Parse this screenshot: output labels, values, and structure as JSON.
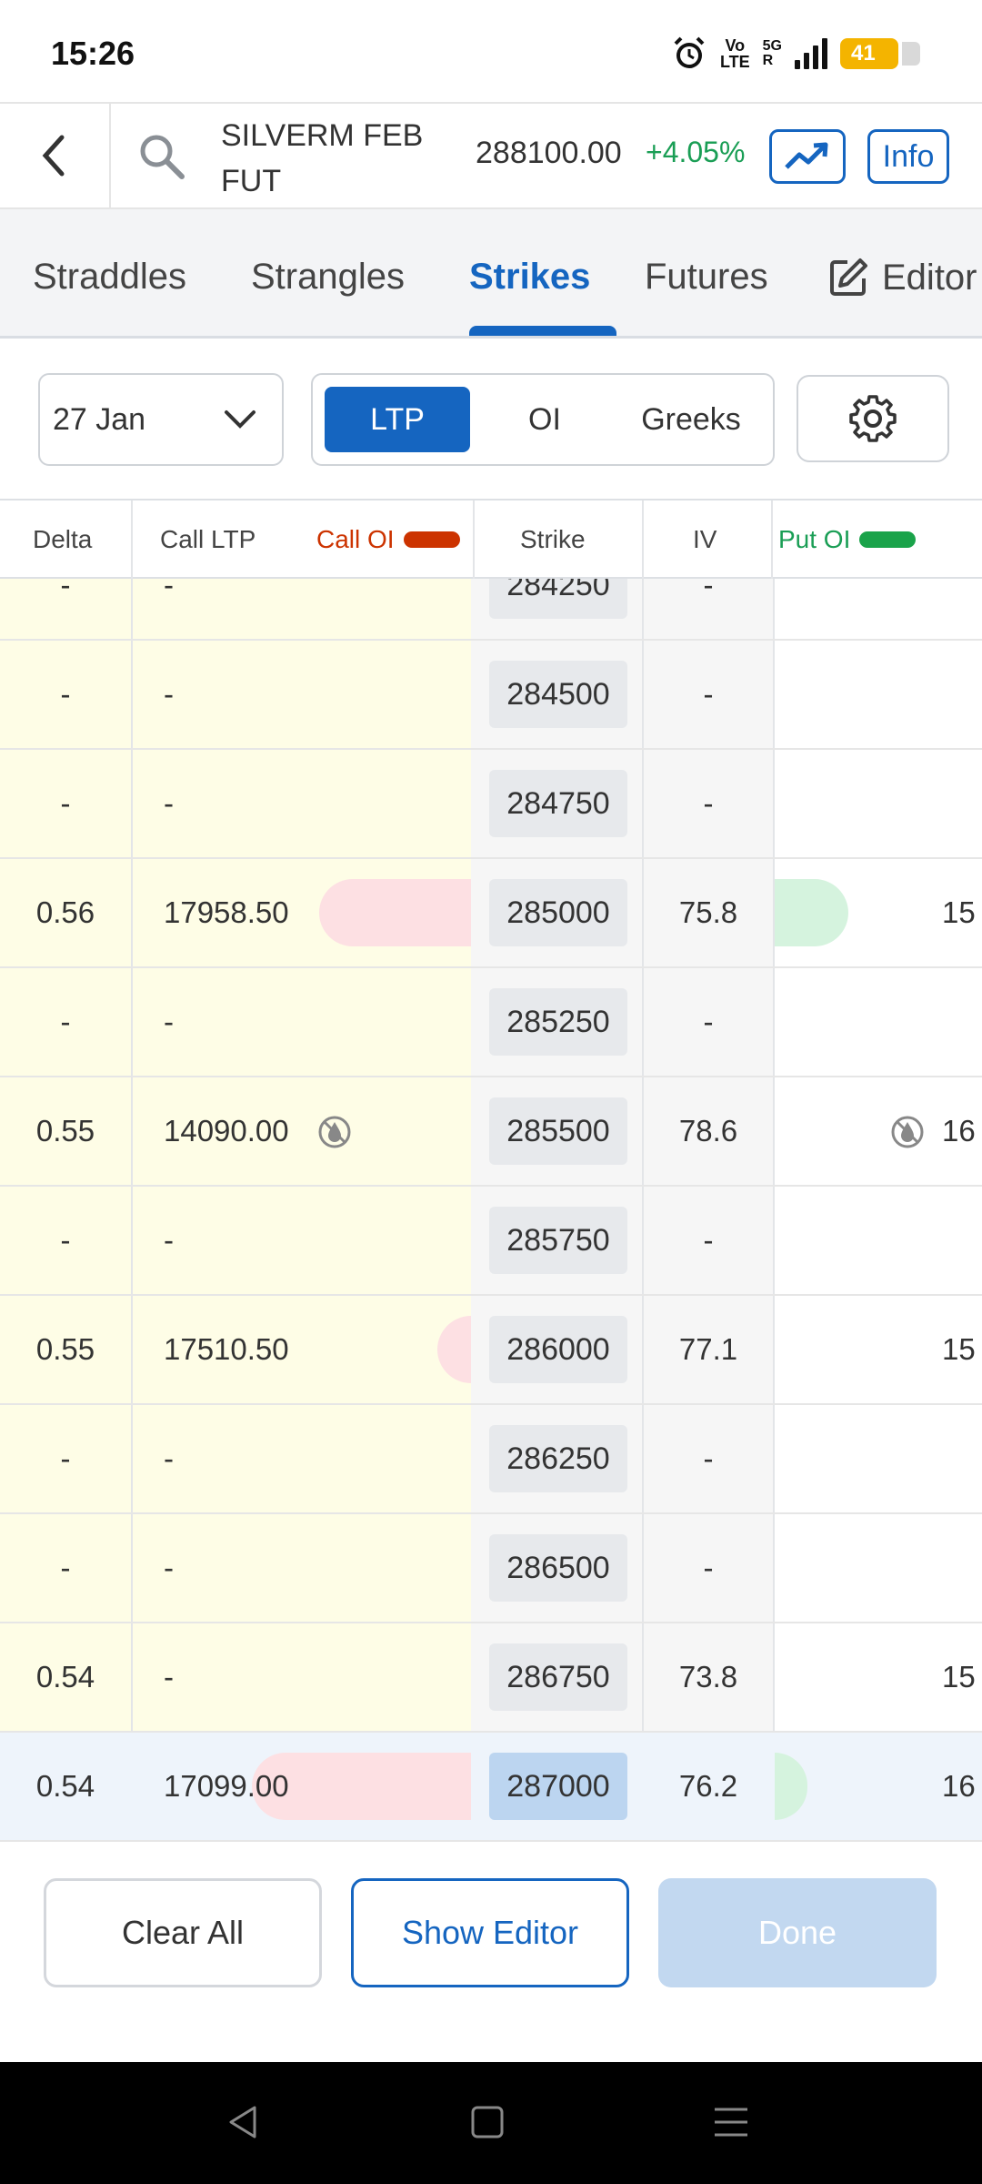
{
  "status_bar": {
    "time": "15:26",
    "volte_top": "Vo",
    "volte_bottom": "LTE",
    "network": "5G",
    "network_sub": "R",
    "battery": "41"
  },
  "header": {
    "symbol_line1": "SILVERM FEB",
    "symbol_line2": "FUT",
    "price": "288100.00",
    "change": "+4.05%",
    "info_label": "Info"
  },
  "tabs": [
    {
      "label": "Straddles"
    },
    {
      "label": "Strangles"
    },
    {
      "label": "Strikes"
    },
    {
      "label": "Futures"
    },
    {
      "label": "Editor"
    }
  ],
  "controls": {
    "expiry": "27 Jan",
    "segments": [
      {
        "label": "LTP"
      },
      {
        "label": "OI"
      },
      {
        "label": "Greeks"
      }
    ]
  },
  "table": {
    "headers": {
      "delta": "Delta",
      "call_ltp": "Call LTP",
      "call_oi": "Call OI",
      "strike": "Strike",
      "iv": "IV",
      "put_oi": "Put OI"
    },
    "rows": [
      {
        "delta": "-",
        "call_ltp": "-",
        "strike": "284250",
        "iv": "-",
        "put": "",
        "call_oi_level": 0,
        "put_oi_level": 0
      },
      {
        "delta": "-",
        "call_ltp": "-",
        "strike": "284500",
        "iv": "-",
        "put": "",
        "call_oi_level": 0,
        "put_oi_level": 0
      },
      {
        "delta": "-",
        "call_ltp": "-",
        "strike": "284750",
        "iv": "-",
        "put": "",
        "call_oi_level": 0,
        "put_oi_level": 0
      },
      {
        "delta": "0.56",
        "call_ltp": "17958.50",
        "strike": "285000",
        "iv": "75.8",
        "put": "15",
        "call_oi_level": 0.45,
        "put_oi_level": 0.45
      },
      {
        "delta": "-",
        "call_ltp": "-",
        "strike": "285250",
        "iv": "-",
        "put": "",
        "call_oi_level": 0,
        "put_oi_level": 0
      },
      {
        "delta": "0.55",
        "call_ltp": "14090.00",
        "strike": "285500",
        "iv": "78.6",
        "put": "16",
        "call_oi_level": 0,
        "put_oi_level": 0
      },
      {
        "delta": "-",
        "call_ltp": "-",
        "strike": "285750",
        "iv": "-",
        "put": "",
        "call_oi_level": 0,
        "put_oi_level": 0
      },
      {
        "delta": "0.55",
        "call_ltp": "17510.50",
        "strike": "286000",
        "iv": "77.1",
        "put": "15",
        "call_oi_level": 0.1,
        "put_oi_level": 0
      },
      {
        "delta": "-",
        "call_ltp": "-",
        "strike": "286250",
        "iv": "-",
        "put": "",
        "call_oi_level": 0,
        "put_oi_level": 0
      },
      {
        "delta": "-",
        "call_ltp": "-",
        "strike": "286500",
        "iv": "-",
        "put": "",
        "call_oi_level": 0,
        "put_oi_level": 0
      },
      {
        "delta": "0.54",
        "call_ltp": "-",
        "strike": "286750",
        "iv": "73.8",
        "put": "15",
        "call_oi_level": 0,
        "put_oi_level": 0
      },
      {
        "delta": "0.54",
        "call_ltp": "17099.00",
        "strike": "287000",
        "iv": "76.2",
        "put": "16",
        "call_oi_level": 0.65,
        "put_oi_level": 0.2
      }
    ]
  },
  "bottom": {
    "clear_all": "Clear All",
    "show_editor": "Show Editor",
    "done": "Done"
  },
  "colors": {
    "accent": "#1565c0",
    "positive": "#1a9e55",
    "call_oi": "#cc3300",
    "put_oi": "#1aa34a",
    "call_bg": "#fefde6"
  }
}
